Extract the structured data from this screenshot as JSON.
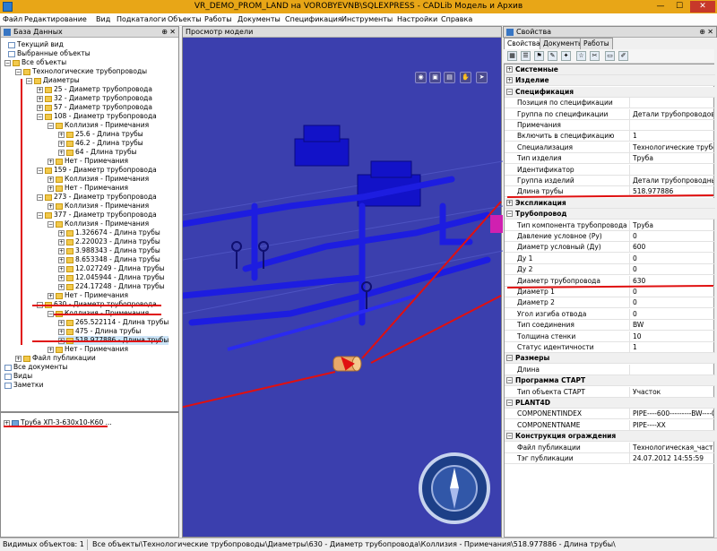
{
  "window": {
    "title": "VR_DEMO_PROM_LAND на VOROBYEVNB\\SQLEXPRESS - CADLib Модель и Архив",
    "min": "—",
    "max": "☐",
    "close": "✕"
  },
  "menu": [
    "Файл",
    "Редактирование",
    "Вид",
    "Подкаталоги",
    "Объекты",
    "Работы",
    "Документы",
    "Спецификация",
    "Инструменты",
    "Настройки",
    "Справка"
  ],
  "db_panel": {
    "title": "База Данных",
    "pin": "⊕",
    "close": "✕",
    "nodes": [
      {
        "label": "Текущий вид",
        "icon": "doc-icon"
      },
      {
        "label": "Выбранные объекты",
        "icon": "doc-icon"
      },
      {
        "label": "Все объекты",
        "icon": "folder-icon"
      },
      {
        "label": "Технологические трубопроводы",
        "icon": "folder-icon"
      },
      {
        "label": "Диаметры",
        "icon": "folder-icon"
      },
      {
        "label": "25 - Диаметр трубопровода",
        "icon": "folder-icon"
      },
      {
        "label": "32 - Диаметр трубопровода",
        "icon": "folder-icon"
      },
      {
        "label": "57 - Диаметр трубопровода",
        "icon": "folder-icon"
      },
      {
        "label": "108 - Диаметр трубопровода",
        "icon": "folder-icon"
      },
      {
        "label": "Коллизия - Примечания",
        "icon": "folder-icon"
      },
      {
        "label": "25.6 - Длина трубы",
        "icon": "folder-icon"
      },
      {
        "label": "46.2 - Длина трубы",
        "icon": "folder-icon"
      },
      {
        "label": "64 - Длина трубы",
        "icon": "folder-icon"
      },
      {
        "label": "Нет - Примечания",
        "icon": "folder-icon"
      },
      {
        "label": "159 - Диаметр трубопровода",
        "icon": "folder-icon"
      },
      {
        "label": "Коллизия - Примечания",
        "icon": "folder-icon"
      },
      {
        "label": "Нет - Примечания",
        "icon": "folder-icon"
      },
      {
        "label": "273 - Диаметр трубопровода",
        "icon": "folder-icon"
      },
      {
        "label": "Коллизия - Примечания",
        "icon": "folder-icon"
      },
      {
        "label": "377 - Диаметр трубопровода",
        "icon": "folder-icon"
      },
      {
        "label": "Коллизия - Примечания",
        "icon": "folder-icon"
      },
      {
        "label": "1.326674 - Длина трубы",
        "icon": "folder-icon"
      },
      {
        "label": "2.220023 - Длина трубы",
        "icon": "folder-icon"
      },
      {
        "label": "3.988343 - Длина трубы",
        "icon": "folder-icon"
      },
      {
        "label": "8.653348 - Длина трубы",
        "icon": "folder-icon"
      },
      {
        "label": "12.027249 - Длина трубы",
        "icon": "folder-icon"
      },
      {
        "label": "12.045944 - Длина трубы",
        "icon": "folder-icon"
      },
      {
        "label": "224.17248 - Длина трубы",
        "icon": "folder-icon"
      },
      {
        "label": "Нет - Примечания",
        "icon": "folder-icon"
      },
      {
        "label": "630 - Диаметр трубопровода",
        "icon": "folder-icon"
      },
      {
        "label": "Коллизия - Примечания",
        "icon": "folder-icon"
      },
      {
        "label": "265.522114 - Длина трубы",
        "icon": "folder-icon"
      },
      {
        "label": "475 - Длина трубы",
        "icon": "folder-icon"
      },
      {
        "label": "518.977886 - Длина трубы",
        "icon": "folder-icon"
      },
      {
        "label": "Нет - Примечания",
        "icon": "folder-icon"
      },
      {
        "label": "Файл публикации",
        "icon": "folder-icon"
      },
      {
        "label": "Все документы",
        "icon": "doc-icon"
      },
      {
        "label": "Виды",
        "icon": "doc-icon"
      },
      {
        "label": "Заметки",
        "icon": "doc-icon"
      }
    ],
    "selected_object": "Труба ХП-3-630х10-К60 ..."
  },
  "model_view": {
    "title": "Просмотр модели",
    "tools": [
      "◉",
      "▣",
      "▤",
      "✋",
      "➤"
    ]
  },
  "props_panel": {
    "title": "Свойства",
    "pin": "⊕",
    "close": "✕",
    "tabs": [
      "Свойства",
      "Документы",
      "Работы"
    ],
    "toolbar": [
      "▦",
      "☰",
      "⚑",
      "✎",
      "✦",
      "☆",
      "✂",
      "▭",
      "✐"
    ],
    "rows": [
      {
        "cat": true,
        "exp": "+",
        "name": "Системные"
      },
      {
        "cat": true,
        "exp": "+",
        "name": "Изделие"
      },
      {
        "cat": true,
        "exp": "−",
        "name": "Спецификация"
      },
      {
        "name": "Позиция по спецификации",
        "value": ""
      },
      {
        "name": "Группа по спецификации",
        "value": "Детали трубопроводов"
      },
      {
        "name": "Примечания",
        "value": ""
      },
      {
        "name": "Включить в спецификацию",
        "value": "1"
      },
      {
        "name": "Специализация",
        "value": "Технологические трубопро..."
      },
      {
        "name": "Тип изделия",
        "value": "Труба"
      },
      {
        "name": "Идентификатор",
        "value": ""
      },
      {
        "name": "Группа изделий",
        "value": "Детали трубопроводные"
      },
      {
        "name": "Длина трубы",
        "value": "518.977886"
      },
      {
        "cat": true,
        "exp": "+",
        "name": "Экспликация"
      },
      {
        "cat": true,
        "exp": "−",
        "name": "Трубопровод"
      },
      {
        "name": "Тип компонента трубопровода",
        "value": "Труба"
      },
      {
        "name": "Давление условное (Ру)",
        "value": "0"
      },
      {
        "name": "Диаметр условный (Ду)",
        "value": "600"
      },
      {
        "name": "Ду 1",
        "value": "0"
      },
      {
        "name": "Ду 2",
        "value": "0"
      },
      {
        "name": "Диаметр трубопровода",
        "value": "630"
      },
      {
        "name": "Диаметр 1",
        "value": "0"
      },
      {
        "name": "Диаметр 2",
        "value": "0"
      },
      {
        "name": "Угол изгиба отвода",
        "value": "0"
      },
      {
        "name": "Тип соединения",
        "value": "BW"
      },
      {
        "name": "Толщина стенки",
        "value": "10"
      },
      {
        "name": "Статус идентичности",
        "value": "1"
      },
      {
        "cat": true,
        "exp": "−",
        "name": "Размеры"
      },
      {
        "name": "Длина",
        "value": ""
      },
      {
        "cat": true,
        "exp": "−",
        "name": "Программа СТАРТ"
      },
      {
        "name": "Тип объекта СТАРТ",
        "value": "Участок"
      },
      {
        "cat": true,
        "exp": "−",
        "name": "PLANT4D"
      },
      {
        "name": "COMPONENTINDEX",
        "value": "PIPE----600---------BW----0..."
      },
      {
        "name": "COMPONENTNAME",
        "value": "PIPE----XX"
      },
      {
        "cat": true,
        "exp": "−",
        "name": "Конструкция ограждения"
      },
      {
        "name": "Файл публикации",
        "value": "Технологическая_часть_М..."
      },
      {
        "name": "Тэг публикации",
        "value": "24.07.2012 14:55:59"
      }
    ]
  },
  "status": {
    "visible": "Видимых объектов: 1",
    "path": "Все объекты\\Технологические трубопроводы\\Диаметры\\630 - Диаметр трубопровода\\Коллизия - Примечания\\518.977886 - Длина трубы\\"
  },
  "colors": {
    "accent": "#e8a617",
    "highlight": "#e01010",
    "model_bg": "#3b3fae"
  }
}
